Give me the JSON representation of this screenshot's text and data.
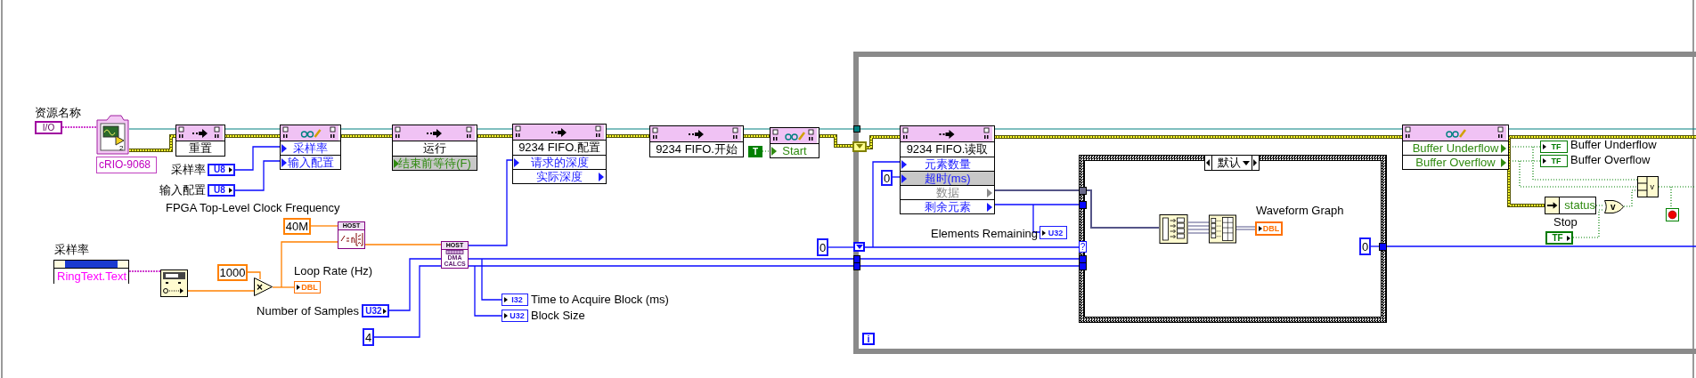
{
  "io_constant": {
    "label": "资源名称",
    "type": "I/O"
  },
  "target": {
    "name": "cRIO-9068",
    "count": "2"
  },
  "nodes": [
    {
      "kind": "method",
      "title": "重置"
    },
    {
      "kind": "property",
      "rows": [
        {
          "text": "采样率",
          "kind": "numeric",
          "output": false,
          "default": false
        },
        {
          "text": "输入配置",
          "kind": "numeric",
          "output": false,
          "default": false
        }
      ]
    },
    {
      "kind": "method",
      "title": "运行",
      "rows": [
        {
          "text": "结束前等待(F)",
          "kind": "boolean",
          "output": false,
          "default": true
        }
      ]
    },
    {
      "kind": "method",
      "title": "9234 FIFO.配置",
      "rows": [
        {
          "text": "请求的深度",
          "kind": "numeric",
          "output": false,
          "default": false
        },
        {
          "text": "实际深度",
          "kind": "numeric",
          "output": true,
          "default": false
        }
      ]
    },
    {
      "kind": "method",
      "title": "9234 FIFO.开始"
    },
    {
      "kind": "property",
      "rows": [
        {
          "text": "Start",
          "kind": "boolean",
          "output": false,
          "default": false
        }
      ]
    },
    {
      "kind": "method",
      "title": "9234 FIFO.读取",
      "rows": [
        {
          "text": "元素数量",
          "kind": "numeric",
          "output": false,
          "default": false
        },
        {
          "text": "超时(ms)",
          "kind": "numeric",
          "output": false,
          "default": true
        },
        {
          "text": "数据",
          "kind": "array",
          "output": true,
          "default": false
        },
        {
          "text": "剩余元素",
          "kind": "numeric",
          "output": true,
          "default": false
        }
      ]
    },
    {
      "kind": "property",
      "rows": [
        {
          "text": "Buffer Underflow",
          "kind": "boolean",
          "output": true,
          "default": false
        },
        {
          "text": "Buffer Overflow",
          "kind": "boolean",
          "output": true,
          "default": false
        }
      ]
    }
  ],
  "terminals": [
    {
      "kind": "control",
      "color": "#1a1aff",
      "type": "U8",
      "label": "采样率"
    },
    {
      "kind": "control",
      "color": "#1a1aff",
      "type": "U8",
      "label": "输入配置"
    },
    {
      "kind": "ring",
      "value": "RingText.Text",
      "label": "采样率"
    },
    {
      "kind": "indicator",
      "color": "#ff7000",
      "type": "DBL",
      "label": "Loop Rate (Hz)"
    },
    {
      "kind": "control",
      "color": "#1a1aff",
      "type": "U32",
      "label": "Number of Samples"
    },
    {
      "kind": "indicator",
      "color": "#1a1aff",
      "type": "I32",
      "label": "Time to Acquire Block (ms)"
    },
    {
      "kind": "indicator",
      "color": "#1a1aff",
      "type": "U32",
      "label": "Block Size"
    },
    {
      "kind": "indicator",
      "color": "#1a1aff",
      "type": "U32",
      "label": "Elements Remaining"
    },
    {
      "kind": "array_indicator",
      "color": "#ff7000",
      "type": "DBL",
      "label": "Waveform Graph"
    },
    {
      "kind": "indicator",
      "color": "#007a00",
      "type": "TF",
      "label": "Buffer Underflow"
    },
    {
      "kind": "indicator",
      "color": "#007a00",
      "type": "TF",
      "label": "Buffer Overflow"
    },
    {
      "kind": "control",
      "color": "#007a00",
      "type": "TF",
      "label": "Stop"
    }
  ],
  "constants": [
    {
      "kind": "numeric",
      "color": "#ff8000",
      "value": "40M",
      "label": "FPGA Top-Level Clock Frequency"
    },
    {
      "kind": "numeric",
      "color": "#ff8000",
      "value": "1000"
    },
    {
      "kind": "numeric",
      "color": "#1a1aff",
      "value": "4"
    },
    {
      "kind": "numeric",
      "color": "#1a1aff",
      "value": "0"
    },
    {
      "kind": "numeric",
      "color": "#1a1aff",
      "value": "0"
    },
    {
      "kind": "numeric",
      "color": "#1a1aff",
      "value": "0"
    },
    {
      "kind": "boolean",
      "color": "#008000",
      "value": "T"
    }
  ],
  "functions": [
    {
      "kind": "convert"
    },
    {
      "kind": "formula",
      "badge": "HOST"
    },
    {
      "kind": "multiply",
      "symbol": "×"
    },
    {
      "kind": "subvi",
      "badge": "HOST",
      "text": "DMA CALCS"
    },
    {
      "kind": "index_array"
    },
    {
      "kind": "build_array"
    },
    {
      "kind": "unbundle",
      "text": "status"
    },
    {
      "kind": "or",
      "symbol": "v"
    },
    {
      "kind": "compound_or",
      "symbol": "v"
    },
    {
      "kind": "stop"
    }
  ],
  "loop": {
    "iteration": "i"
  },
  "case": {
    "selector": "默认",
    "terminal": "?"
  }
}
